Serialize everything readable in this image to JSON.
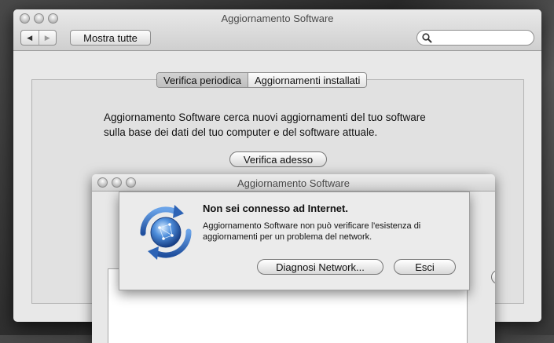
{
  "main_window": {
    "title": "Aggiornamento Software",
    "nav_back": "◀",
    "nav_forward": "▶",
    "show_all_label": "Mostra tutte",
    "search": {
      "value": "",
      "placeholder": ""
    },
    "tabs": [
      {
        "label": "Verifica periodica",
        "active": true
      },
      {
        "label": "Aggiornamenti installati",
        "active": false
      }
    ],
    "description_line1": "Aggiornamento Software cerca nuovi aggiornamenti del tuo software",
    "description_line2": "sulla base dei dati del tuo computer e del software attuale.",
    "check_now_label": "Verifica adesso"
  },
  "update_window": {
    "title": "Aggiornamento Software",
    "help_label": "?"
  },
  "alert": {
    "heading": "Non sei connesso ad Internet.",
    "message": "Aggiornamento Software non può verificare l'esistenza di aggiornamenti per un problema del network.",
    "diagnose_label": "Diagnosi Network...",
    "quit_label": "Esci",
    "icon": "software-update-icon"
  },
  "colors": {
    "window_bg": "#e8e8e8",
    "icon_blue": "#3a78c8"
  }
}
